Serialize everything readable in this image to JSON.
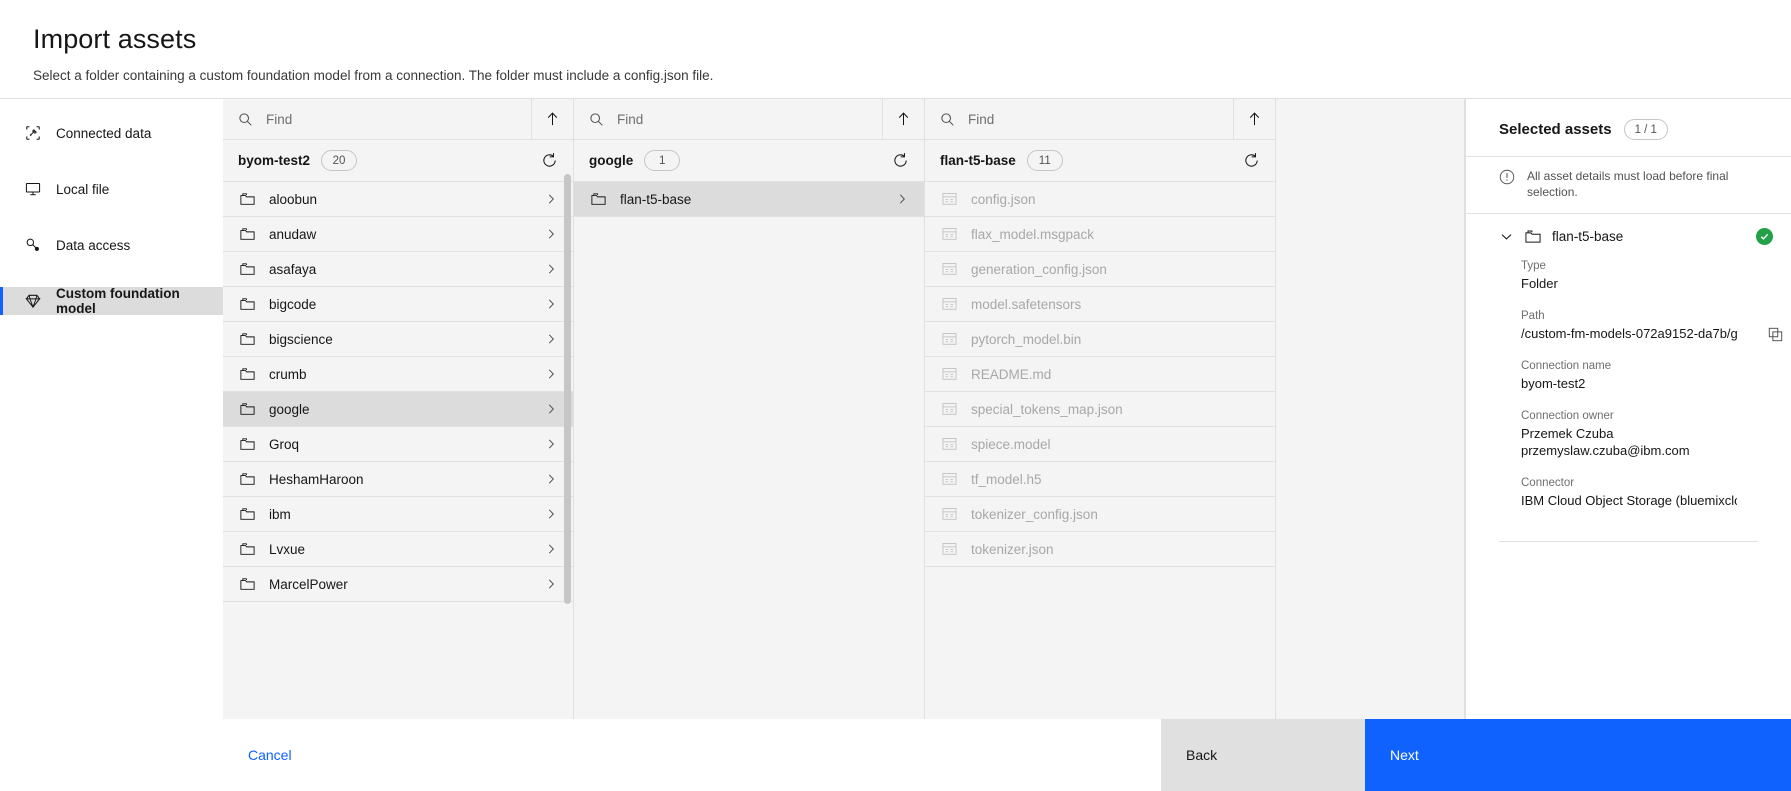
{
  "header": {
    "title": "Import assets",
    "subtitle": "Select a folder containing a custom foundation model from a connection. The folder must include a config.json file."
  },
  "leftnav": {
    "items": [
      {
        "label": "Connected data",
        "icon": "connected-data-icon",
        "active": false
      },
      {
        "label": "Local file",
        "icon": "monitor-icon",
        "active": false
      },
      {
        "label": "Data access",
        "icon": "data-access-icon",
        "active": false
      },
      {
        "label": "Custom foundation model",
        "icon": "gem-icon",
        "active": true
      }
    ]
  },
  "columns": [
    {
      "search_placeholder": "Find",
      "search_value": "",
      "header_title": "byom-test2",
      "count": "20",
      "rows": [
        {
          "label": "aloobun",
          "icon": "folder-icon",
          "selected": false,
          "chevron": true
        },
        {
          "label": "anudaw",
          "icon": "folder-icon",
          "selected": false,
          "chevron": true
        },
        {
          "label": "asafaya",
          "icon": "folder-icon",
          "selected": false,
          "chevron": true
        },
        {
          "label": "bigcode",
          "icon": "folder-icon",
          "selected": false,
          "chevron": true
        },
        {
          "label": "bigscience",
          "icon": "folder-icon",
          "selected": false,
          "chevron": true
        },
        {
          "label": "crumb",
          "icon": "folder-icon",
          "selected": false,
          "chevron": true
        },
        {
          "label": "google",
          "icon": "folder-icon",
          "selected": true,
          "chevron": true
        },
        {
          "label": "Groq",
          "icon": "folder-icon",
          "selected": false,
          "chevron": true
        },
        {
          "label": "HeshamHaroon",
          "icon": "folder-icon",
          "selected": false,
          "chevron": true
        },
        {
          "label": "ibm",
          "icon": "folder-icon",
          "selected": false,
          "chevron": true
        },
        {
          "label": "Lvxue",
          "icon": "folder-icon",
          "selected": false,
          "chevron": true
        },
        {
          "label": "MarcelPower",
          "icon": "folder-icon",
          "selected": false,
          "chevron": true
        }
      ]
    },
    {
      "search_placeholder": "Find",
      "search_value": "",
      "header_title": "google",
      "count": "1",
      "rows": [
        {
          "label": "flan-t5-base",
          "icon": "folder-icon",
          "selected": true,
          "chevron": true
        }
      ]
    },
    {
      "search_placeholder": "Find",
      "search_value": "",
      "header_title": "flan-t5-base",
      "count": "11",
      "rows": [
        {
          "label": "config.json",
          "icon": "file-icon",
          "disabled": true,
          "chevron": false
        },
        {
          "label": "flax_model.msgpack",
          "icon": "file-icon",
          "disabled": true,
          "chevron": false
        },
        {
          "label": "generation_config.json",
          "icon": "file-icon",
          "disabled": true,
          "chevron": false
        },
        {
          "label": "model.safetensors",
          "icon": "file-icon",
          "disabled": true,
          "chevron": false
        },
        {
          "label": "pytorch_model.bin",
          "icon": "file-icon",
          "disabled": true,
          "chevron": false
        },
        {
          "label": "README.md",
          "icon": "file-icon",
          "disabled": true,
          "chevron": false
        },
        {
          "label": "special_tokens_map.json",
          "icon": "file-icon",
          "disabled": true,
          "chevron": false
        },
        {
          "label": "spiece.model",
          "icon": "file-icon",
          "disabled": true,
          "chevron": false
        },
        {
          "label": "tf_model.h5",
          "icon": "file-icon",
          "disabled": true,
          "chevron": false
        },
        {
          "label": "tokenizer_config.json",
          "icon": "file-icon",
          "disabled": true,
          "chevron": false
        },
        {
          "label": "tokenizer.json",
          "icon": "file-icon",
          "disabled": true,
          "chevron": false
        }
      ]
    }
  ],
  "right_panel": {
    "title": "Selected assets",
    "count": "1 / 1",
    "note": "All asset details must load before final selection.",
    "asset_name": "flan-t5-base",
    "status": "valid",
    "fields": [
      {
        "label": "Type",
        "value": "Folder",
        "copyable": false
      },
      {
        "label": "Path",
        "value": "/custom-fm-models-072a9152-da7b/g...",
        "copyable": true
      },
      {
        "label": "Connection name",
        "value": "byom-test2",
        "copyable": false
      },
      {
        "label": "Connection owner",
        "value": "Przemek Czuba\nprzemyslaw.czuba@ibm.com",
        "copyable": false
      },
      {
        "label": "Connector",
        "value": "IBM Cloud Object Storage (bluemixcloudobje...",
        "copyable": false
      }
    ]
  },
  "footer": {
    "cancel_label": "Cancel",
    "back_label": "Back",
    "next_label": "Next"
  },
  "colors": {
    "accent": "#0f62fe",
    "success": "#24a148",
    "surface": "#f4f4f4",
    "border": "#e0e0e0",
    "selected_row": "#dcdcdc"
  }
}
